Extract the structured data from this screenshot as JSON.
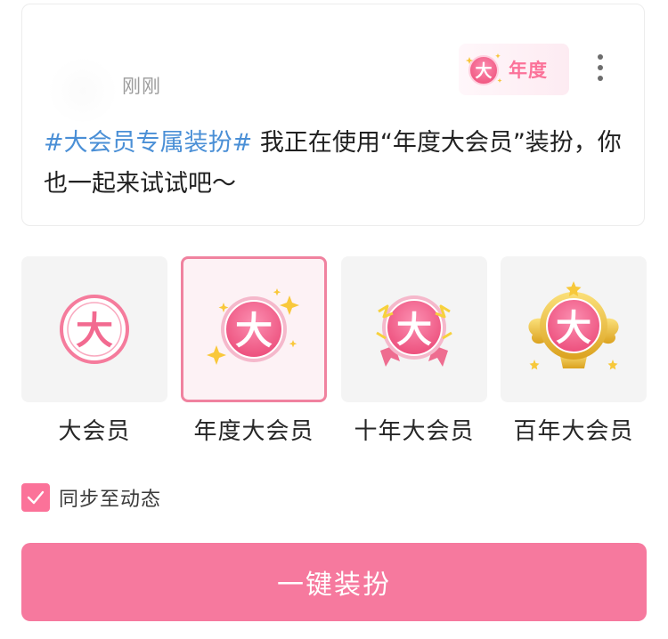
{
  "post": {
    "time": "刚刚",
    "badge_label": "年度",
    "badge_glyph": "大",
    "topic": "#大会员专属装扮#",
    "text": " 我正在使用“年度大会员”装扮，你也一起来试试吧～"
  },
  "options": [
    {
      "label": "大会员",
      "glyph": "大",
      "selected": false,
      "style": "plain"
    },
    {
      "label": "年度大会员",
      "glyph": "大",
      "selected": true,
      "style": "sparkle"
    },
    {
      "label": "十年大会员",
      "glyph": "大",
      "selected": false,
      "style": "ribbon"
    },
    {
      "label": "百年大会员",
      "glyph": "大",
      "selected": false,
      "style": "winged"
    }
  ],
  "sync": {
    "label": "同步至动态",
    "checked": true
  },
  "action": {
    "label": "一键装扮"
  },
  "colors": {
    "brand_pink": "#fb7299",
    "button_pink": "#f6799e",
    "topic_blue": "#4a8fd6",
    "gold": "#f2c232"
  },
  "icons": {
    "more": "more-vertical-icon",
    "check": "check-icon",
    "medal": "vip-medal-icon"
  }
}
